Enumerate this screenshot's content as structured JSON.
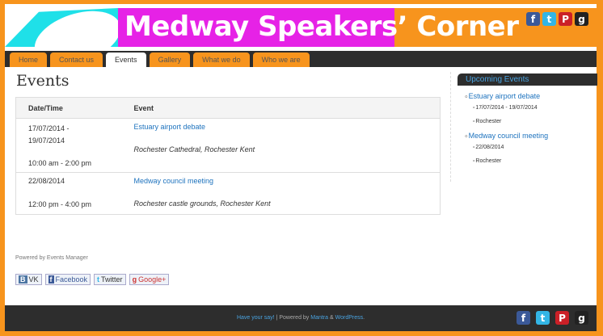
{
  "header": {
    "title": "Medway Speakers’ Corner",
    "social_icons": [
      "facebook-icon",
      "twitter-icon",
      "pinterest-icon",
      "google-plus-icon"
    ]
  },
  "nav": {
    "items": [
      {
        "label": "Home"
      },
      {
        "label": "Contact us"
      },
      {
        "label": "Events"
      },
      {
        "label": "Gallery"
      },
      {
        "label": "What we do"
      },
      {
        "label": "Who we are"
      }
    ],
    "active": "Events"
  },
  "main": {
    "heading": "Events",
    "table": {
      "headers": [
        "Date/Time",
        "Event"
      ],
      "rows": [
        {
          "date": "17/07/2014 -",
          "date2": "19/07/2014",
          "time": "10:00 am - 2:00 pm",
          "event": "Estuary airport debate",
          "location": "Rochester Cathedral, Rochester Kent"
        },
        {
          "date": "22/08/2014",
          "time": "12:00 pm - 4:00 pm",
          "event": "Medway council meeting",
          "location": "Rochester castle grounds, Rochester Kent"
        }
      ]
    },
    "powered": "Powered by Events Manager",
    "share": {
      "vk": "VK",
      "vk_logo": "В",
      "facebook": "Facebook",
      "facebook_logo": "f",
      "twitter": "Twitter",
      "twitter_logo": "t",
      "google": "Google+",
      "google_logo": "g"
    }
  },
  "sidebar": {
    "title": "Upcoming Events",
    "events": [
      {
        "name": "Estuary airport debate",
        "date": "17/07/2014 - 19/07/2014",
        "location": "Rochester"
      },
      {
        "name": "Medway council meeting",
        "date": "22/08/2014",
        "location": "Rochester"
      }
    ]
  },
  "footer": {
    "link1": "Have your say!",
    "sep": " | Powered by ",
    "link2": "Mantra",
    "amp": " & ",
    "link3": "WordPress",
    "dot": "."
  },
  "colors": {
    "accent_orange": "#f7941d",
    "banner_magenta": "#e622e6",
    "banner_cyan": "#1fe0e8",
    "dark_bar": "#2d2d2d",
    "link_blue": "#1e73be"
  }
}
